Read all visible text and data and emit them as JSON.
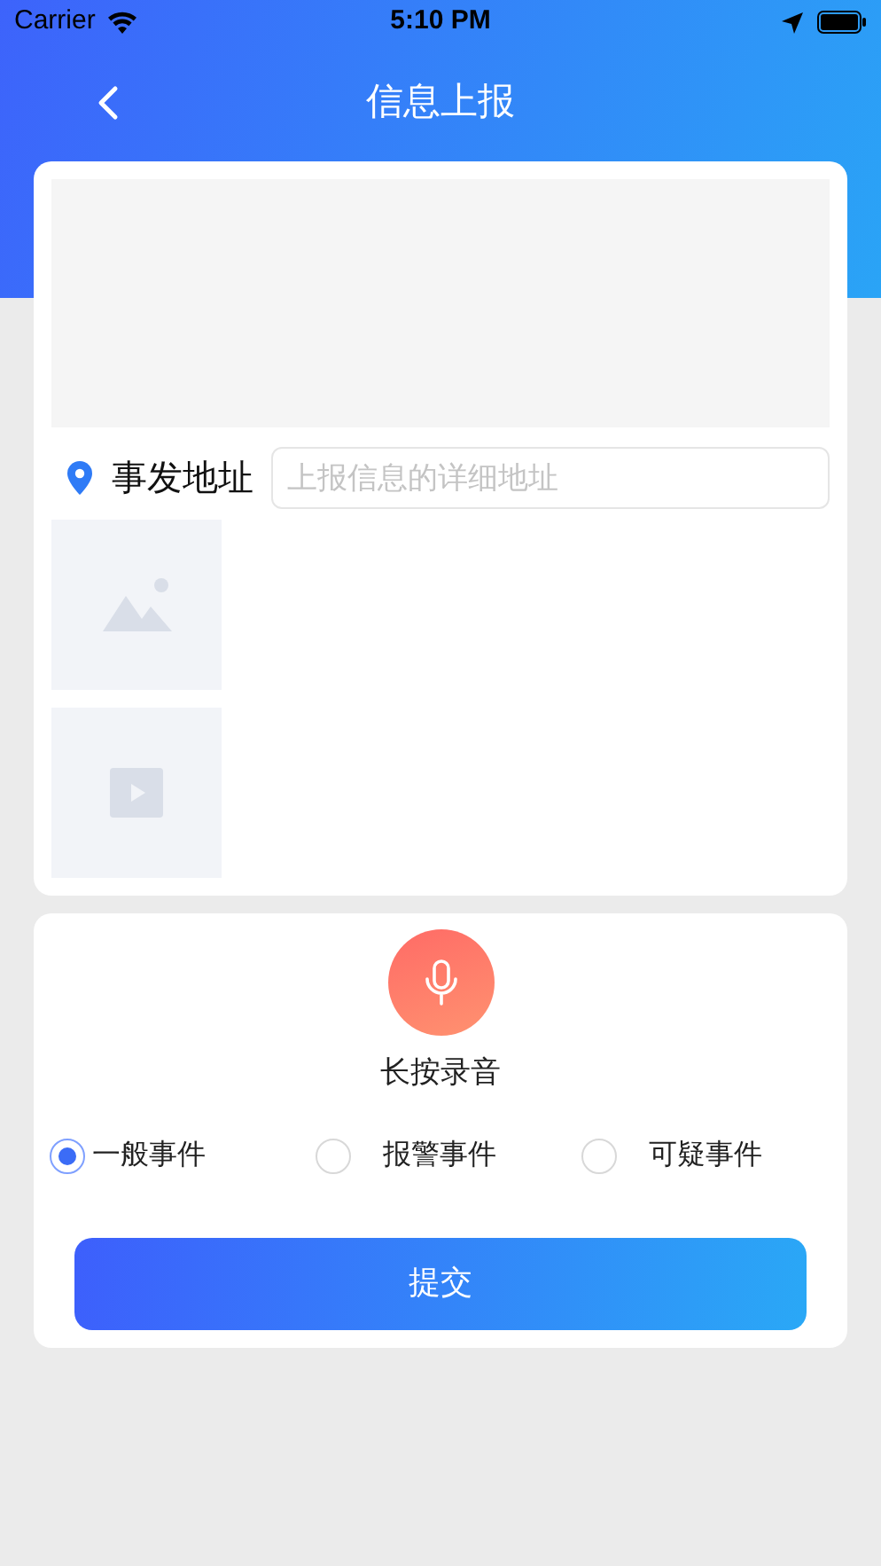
{
  "status_bar": {
    "carrier": "Carrier",
    "time": "5:10 PM"
  },
  "nav": {
    "title": "信息上报"
  },
  "address": {
    "label": "事发地址",
    "placeholder": "上报信息的详细地址"
  },
  "record": {
    "label": "长按录音"
  },
  "event_types": [
    {
      "label": "一般事件",
      "selected": true
    },
    {
      "label": "报警事件",
      "selected": false
    },
    {
      "label": "可疑事件",
      "selected": false
    }
  ],
  "submit": {
    "label": "提交"
  }
}
